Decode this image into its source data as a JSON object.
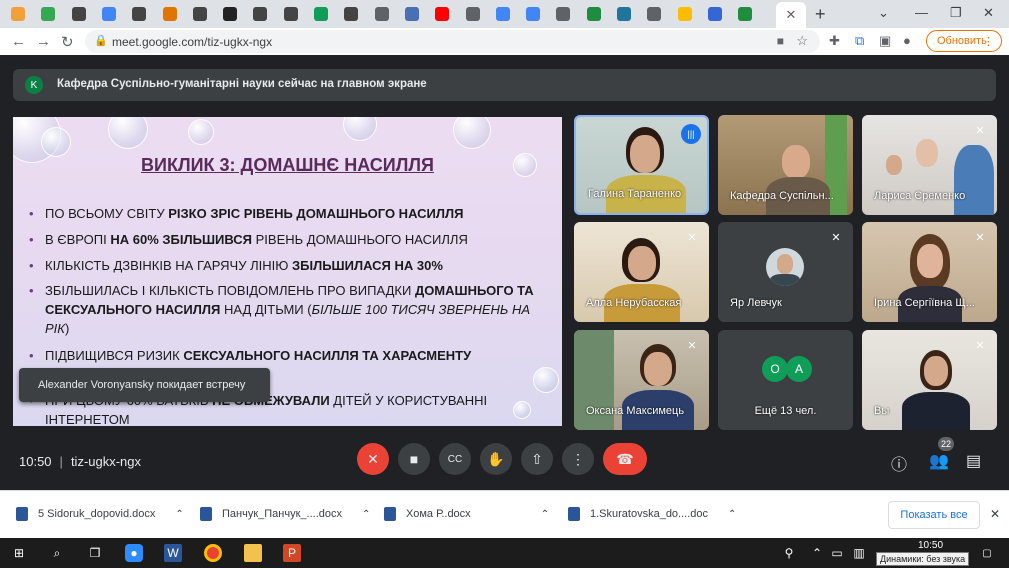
{
  "browser": {
    "tabs": [
      {
        "icon": "orange-circle-icon",
        "color": "#f4a03a"
      },
      {
        "icon": "green-square-icon",
        "color": "#34a853"
      },
      {
        "icon": "feather-icon",
        "color": "#444"
      },
      {
        "icon": "google-icon",
        "color": "#4285f4"
      },
      {
        "icon": "feather-icon",
        "color": "#444"
      },
      {
        "icon": "mountain-icon",
        "color": "#e37400"
      },
      {
        "icon": "feather-icon",
        "color": "#444"
      },
      {
        "icon": "soccer-icon",
        "color": "#222"
      },
      {
        "icon": "feather-icon",
        "color": "#444"
      },
      {
        "icon": "feather-icon",
        "color": "#444"
      },
      {
        "icon": "chart-icon",
        "color": "#0f9d58"
      },
      {
        "icon": "feather-icon",
        "color": "#444"
      },
      {
        "icon": "globe-icon",
        "color": "#5f6368"
      },
      {
        "icon": "puzzle-icon",
        "color": "#4a6fb5"
      },
      {
        "icon": "youtube-icon",
        "color": "#ff0000"
      },
      {
        "icon": "globe-icon",
        "color": "#5f6368"
      },
      {
        "icon": "google-icon",
        "color": "#4285f4"
      },
      {
        "icon": "docs-icon",
        "color": "#4285f4"
      },
      {
        "icon": "globe-icon",
        "color": "#5f6368"
      },
      {
        "icon": "shield-icon",
        "color": "#1e8e3e"
      },
      {
        "icon": "wordpress-icon",
        "color": "#21759b"
      },
      {
        "icon": "globe-icon",
        "color": "#5f6368"
      },
      {
        "icon": "smiley-icon",
        "color": "#fbbc04"
      },
      {
        "icon": "diamond-icon",
        "color": "#3367d6"
      },
      {
        "icon": "classroom-icon",
        "color": "#1e8e3e"
      }
    ],
    "active_tab_close": "✕",
    "new_tab": "+",
    "url": "meet.google.com/tiz-ugkx-ngx",
    "update_label": "Обновить"
  },
  "meet": {
    "banner": {
      "avatar_letter": "K",
      "text": "Кафедра Суспільно-гуманітарні науки сейчас на главном экране"
    },
    "slide": {
      "title": "ВИКЛИК 3: ДОМАШНЄ НАСИЛЛЯ",
      "bullets": [
        {
          "pre": "ПО ВСЬОМУ СВІТУ ",
          "bold": "РІЗКО ЗРІС РІВЕНЬ ДОМАШНЬОГО НАСИЛЛЯ",
          "post": ""
        },
        {
          "pre": "В ЄВРОПІ ",
          "bold": "НА 60% ЗБІЛЬШИВСЯ",
          "post": " РІВЕНЬ ДОМАШНЬОГО НАСИЛЛЯ"
        },
        {
          "pre": "КІЛЬКІСТЬ ДЗВІНКІВ НА ГАРЯЧУ ЛІНІЮ ",
          "bold": "ЗБІЛЬШИЛАСЯ НА 30%",
          "post": ""
        },
        {
          "pre": "ЗБІЛЬШИЛАСЬ І КІЛЬКІСТЬ ПОВІДОМЛЕНЬ ПРО ВИПАДКИ ",
          "bold": "ДОМАШНЬОГО ТА СЕКСУАЛЬНОГО НАСИЛЛЯ",
          "post": " НАД ДІТЬМИ (",
          "italic": "БІЛЬШЕ 100 ТИСЯЧ ЗВЕРНЕНЬ НА РІК",
          "post2": ")"
        },
        {
          "pre": "ПІДВИЩИВСЯ РИЗИК ",
          "bold": "СЕКСУАЛЬНОГО НАСИЛЛЯ ТА ХАРАСМЕНТУ",
          "post": ""
        },
        {
          "pre": "ПРИ ЦЬОМУ 60% БАТЬКІВ ",
          "bold": "НЕ ОБМЕЖУВАЛИ",
          "post": " ДІТЕЙ У КОРИСТУВАННІ ІНТЕРНЕТОМ"
        }
      ]
    },
    "toast": "Alexander Voronyansky покидает встречу",
    "participants": [
      {
        "name": "Галина Тараненко"
      },
      {
        "name": "Кафедра Суспільн..."
      },
      {
        "name": "Лариса Єременко"
      },
      {
        "name": "Алла Нерубасская"
      },
      {
        "name": "Яр Левчук"
      },
      {
        "name": "Ірина Сергіївна Щ..."
      },
      {
        "name": "Оксана Максимець"
      },
      {
        "name": "Ещё 13 чел.",
        "avatars": [
          "О",
          "А"
        ]
      },
      {
        "name": "Вы"
      }
    ],
    "controls": {
      "time": "10:50",
      "meeting_code": "tiz-ugkx-ngx",
      "participant_count": "22"
    }
  },
  "downloads": {
    "items": [
      {
        "name": "5 Sidoruk_dopovid.docx"
      },
      {
        "name": "Панчук_Панчук_....docx"
      },
      {
        "name": "Хома Р..docx"
      },
      {
        "name": "1.Skuratovska_do....doc"
      }
    ],
    "show_all": "Показать все"
  },
  "taskbar": {
    "time": "10:50",
    "tooltip": "Динамики: без звука"
  }
}
